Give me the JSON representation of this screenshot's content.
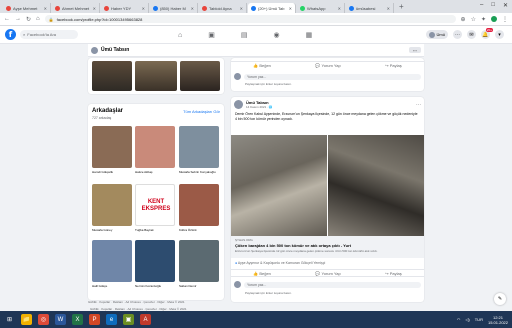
{
  "browser": {
    "tabs": [
      {
        "label": "Ayşe Mehmet",
        "color": "#e8453c"
      },
      {
        "label": "Ahmet Mehmet",
        "color": "#e8453c"
      },
      {
        "label": "Haber YDY",
        "color": "#e8453c"
      },
      {
        "label": "(850) Haber M",
        "color": "#1877f2"
      },
      {
        "label": "Tabloid Ayna",
        "color": "#e8453c"
      },
      {
        "label": "(20+) Ümü Tab",
        "color": "#1877f2",
        "active": true
      },
      {
        "label": "WhatsApp",
        "color": "#25d366"
      },
      {
        "label": "ümüsabesi",
        "color": "#1877f2"
      }
    ],
    "new_tab": "+",
    "url": "facebook.com/profile.php?id=100013495663828",
    "window_controls": [
      "–",
      "□",
      "✕"
    ]
  },
  "facebook": {
    "logo": "f",
    "search_placeholder": "Facebook'ta Ara",
    "nav_icons": [
      "home-icon",
      "watch-icon",
      "marketplace-icon",
      "groups-icon",
      "gaming-icon"
    ],
    "nav_glyphs": [
      "⌂",
      "▣",
      "▤",
      "◉",
      "▦"
    ],
    "user_pill": "Ümü",
    "notif_count": "20+",
    "profile_name": "Ümü Tabsın",
    "more_label": "···"
  },
  "friends": {
    "title": "Arkadaşlar",
    "see_all": "Tüm Arkadaşları Gör",
    "count": "727 arkadaş",
    "items": [
      {
        "name": "Hamdi Gökçelik",
        "color": "#8a6b55"
      },
      {
        "name": "Hatice Akbaş",
        "color": "#c98a7a"
      },
      {
        "name": "Mustafa Sebrin Konyalıoğlu",
        "color": "#7e8f9e"
      },
      {
        "name": "Mustafa Güney",
        "color": "#a38a5e"
      },
      {
        "name": "Tuğba Bayrak",
        "color": "#ffffff"
      },
      {
        "name": "Kübra Öztürk",
        "color": "#9b5a47"
      },
      {
        "name": "Halil Gökçe",
        "color": "#6f86a8"
      },
      {
        "name": "Nermin Kozanlıoğlu",
        "color": "#2d4c6f"
      },
      {
        "name": "Saban Demir",
        "color": "#5b6a71"
      }
    ],
    "logo_text": "KENT EKSPRES"
  },
  "footer": "Gizlilik · Koşullar · Reklam · Ad Choices · Çerezler · Diğer · Meta © 2021",
  "post_top": {
    "like": "Beğen",
    "comment": "Yorum Yap",
    "share": "Paylaş",
    "comment_placeholder": "Yorum yaz...",
    "hint": "Paylaşmak için Enter tuşuna basın."
  },
  "post": {
    "author": "Ümü Tabsın",
    "time": "14 Kasım 2021 · 🌐",
    "text": "Demir Ören Kabul Ayşeninde, Erzurum'un Şenkaya İlçesinde, 12 gün önce meydana gelen çökme ve göçük nedeniyle 4 bin 500 ton kömür yerinden oynadı.",
    "link_domain": "ŞYHAS.ORG",
    "link_title": "Çöken barajdan 4 bin 500 ton kömür ve atık ortaya çıktı - Yurt",
    "link_desc": "Erzurum'un Şenkaya ilçesinde 12 gün önce meydana gelen çökme sonucu 4 bin 500 ton kömürlü atık sızdı.",
    "reactions": "Ayşe Ayşenur & Kapüşonlu ve Kamuran Gökçeli Yemişçi",
    "like": "Beğen",
    "comment": "Yorum Yap",
    "share": "Paylaş",
    "comment_placeholder": "Yorum yaz...",
    "hint": "Paylaşmak için Enter tuşuna basın."
  },
  "taskbar": {
    "apps": [
      "start-icon",
      "file-explorer-icon",
      "chrome-icon",
      "word-icon",
      "excel-icon",
      "powerpoint-icon",
      "edge-icon",
      "photos-icon",
      "acrobat-icon"
    ],
    "app_colors": [
      "#1f3656",
      "#f2b200",
      "#dd4b39",
      "#2b579a",
      "#217346",
      "#d24726",
      "#0f6cbd",
      "#6b8e23",
      "#c0392b"
    ],
    "app_glyphs": [
      "⊞",
      "📁",
      "◎",
      "W",
      "X",
      "P",
      "e",
      "▣",
      "A"
    ],
    "lang": "TUR",
    "time": "12:21",
    "date": "15.01.2022"
  }
}
